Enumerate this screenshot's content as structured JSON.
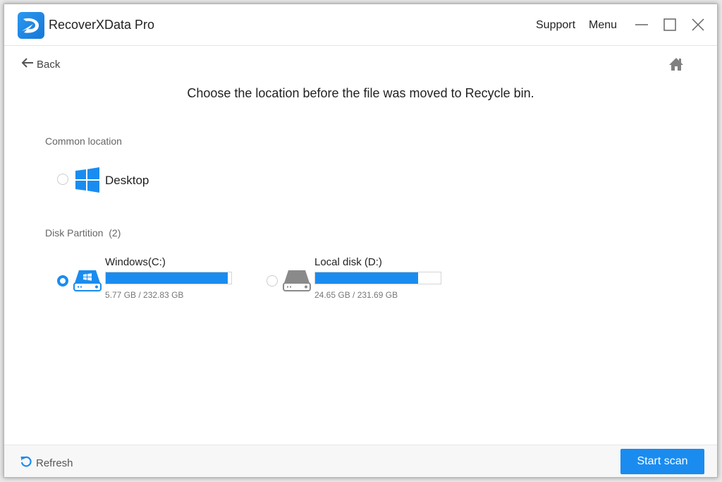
{
  "titlebar": {
    "app_title": "RecoverXData Pro",
    "support_label": "Support",
    "menu_label": "Menu",
    "logo_icon": "recoverxdata-logo-icon",
    "controls": [
      "minimize-icon",
      "maximize-icon",
      "close-icon"
    ]
  },
  "nav": {
    "back_label": "Back",
    "back_icon": "arrow-left-icon",
    "home_icon": "home-icon"
  },
  "main": {
    "headline": "Choose the location before the file was moved to Recycle bin.",
    "common_location": {
      "label": "Common location",
      "items": [
        {
          "label": "Desktop",
          "icon": "windows-logo-icon",
          "selected": false
        }
      ]
    },
    "disk_partition": {
      "label": "Disk Partition",
      "count": "(2)",
      "disks": [
        {
          "name": "Windows(C:)",
          "size_text": "5.77 GB / 232.83 GB",
          "bar_fill_percent": 97,
          "selected": true,
          "icon": "system-drive-icon",
          "accent": "#1a8cf0"
        },
        {
          "name": "Local disk (D:)",
          "size_text": "24.65 GB / 231.69 GB",
          "bar_fill_percent": 82,
          "selected": false,
          "icon": "hard-drive-icon",
          "accent": "#8a8a8a"
        }
      ]
    }
  },
  "footer": {
    "refresh_label": "Refresh",
    "refresh_icon": "refresh-icon",
    "start_scan_label": "Start scan"
  },
  "colors": {
    "accent": "#1a8cf0",
    "background": "#ffffff",
    "footer_background": "#f7f7f7"
  }
}
